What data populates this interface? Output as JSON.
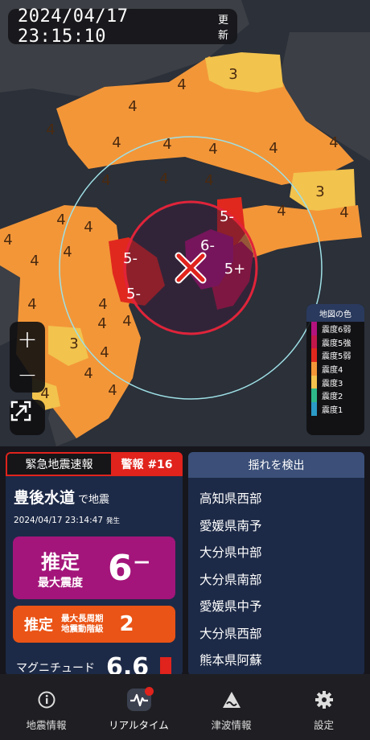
{
  "header": {
    "time": "2024/04/17  23:15:10",
    "update_label": "更新"
  },
  "map": {
    "zoom_in": "+",
    "zoom_out": "−",
    "labels": [
      "3",
      "4",
      "4",
      "4",
      "4",
      "4",
      "4",
      "4",
      "4",
      "4",
      "4",
      "4",
      "3",
      "4",
      "4",
      "4",
      "4",
      "5-",
      "6-",
      "5+",
      "4",
      "5-",
      "5-",
      "4",
      "4",
      "4",
      "4",
      "4",
      "4",
      "4",
      "3",
      "4",
      "4",
      "4"
    ]
  },
  "legend": {
    "title": "地図の色",
    "items": [
      {
        "label": "震度6弱",
        "color": "#b3127f"
      },
      {
        "label": "震度5強",
        "color": "#c2174a"
      },
      {
        "label": "震度5弱",
        "color": "#e0281e"
      },
      {
        "label": "震度4",
        "color": "#f39638"
      },
      {
        "label": "震度3",
        "color": "#f2c34d"
      },
      {
        "label": "震度2",
        "color": "#2eb88a"
      },
      {
        "label": "震度1",
        "color": "#2b9bc7"
      }
    ]
  },
  "eew": {
    "title": "緊急地震速報",
    "alert": "警報 #16",
    "region": "豊後水道",
    "region_suffix": "で地震",
    "origin_time": "2024/04/17 23:14:47",
    "origin_label": "発生",
    "intensity_label_1": "推定",
    "intensity_label_2": "最大震度",
    "intensity_value": "6⁻",
    "lpgm_label_1": "推定",
    "lpgm_label_2a": "最大長周期",
    "lpgm_label_2b": "地震動階級",
    "lpgm_value": "2",
    "magnitude_label": "マグニチュード",
    "magnitude_value": "6.6"
  },
  "detected": {
    "title": "揺れを検出",
    "items": [
      "高知県西部",
      "愛媛県南予",
      "大分県中部",
      "大分県南部",
      "愛媛県中予",
      "大分県西部",
      "熊本県阿蘇"
    ]
  },
  "nav": {
    "items": [
      {
        "label": "地震情報",
        "icon": "info-icon"
      },
      {
        "label": "リアルタイム",
        "icon": "realtime-icon"
      },
      {
        "label": "津波情報",
        "icon": "tsunami-icon"
      },
      {
        "label": "設定",
        "icon": "gear-icon"
      }
    ]
  }
}
